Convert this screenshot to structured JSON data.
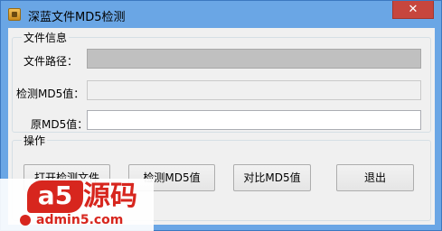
{
  "window": {
    "title": "深蓝文件MD5检测",
    "close_label": "✕"
  },
  "info_group": {
    "title": "文件信息",
    "path_label": "文件路径：",
    "path_value": "",
    "detected_label": "检测MD5值：",
    "detected_value": "",
    "original_label": "原MD5值：",
    "original_value": ""
  },
  "ops_group": {
    "title": "操作",
    "open_button": "打开检测文件",
    "detect_button": "检测MD5值",
    "compare_button": "对比MD5值",
    "exit_button": "退出"
  },
  "watermark": {
    "logo": "a5",
    "brand": "源码",
    "url": "admin5.com"
  },
  "colors": {
    "titlebar": "#6aa6e5",
    "close": "#c7463d",
    "watermark": "#d7261e"
  }
}
